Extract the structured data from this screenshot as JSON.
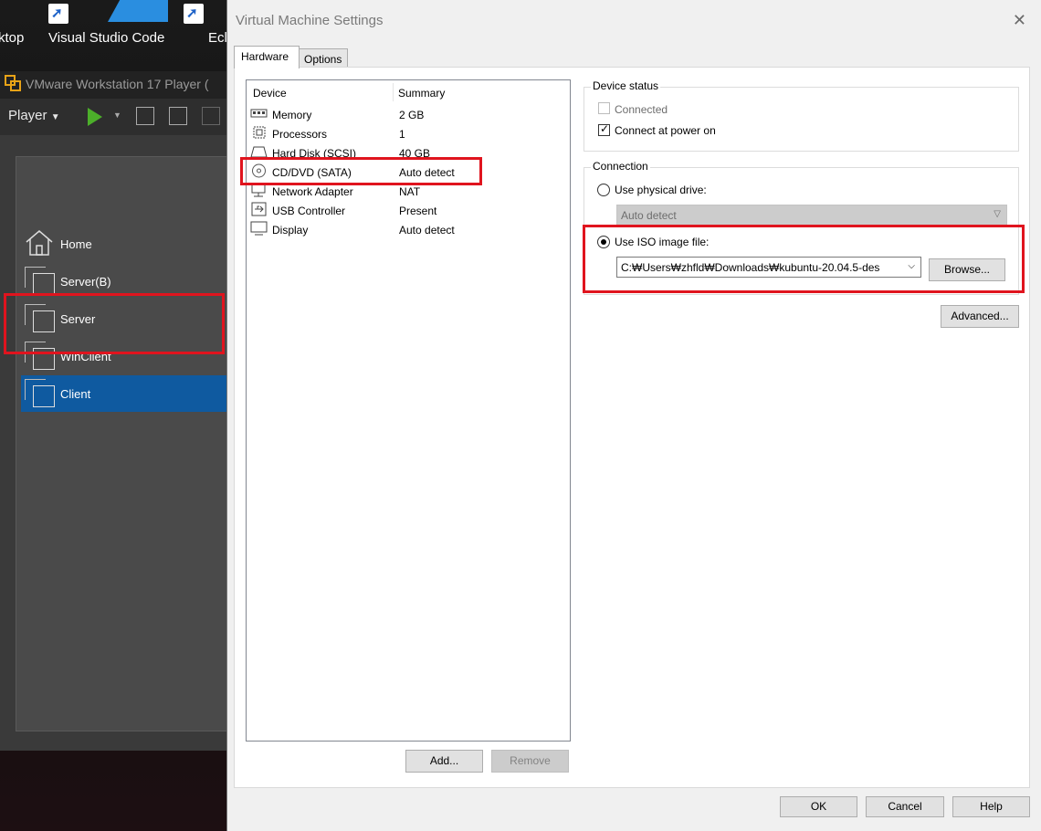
{
  "desktop": {
    "icons": [
      {
        "label": "ktop"
      },
      {
        "label": "Visual Studio Code"
      },
      {
        "label": "Ecl"
      }
    ]
  },
  "vmware": {
    "title": "VMware Workstation 17 Player (",
    "player_menu": "Player",
    "library": [
      {
        "label": "Home",
        "icon": "home-icon"
      },
      {
        "label": "Server(B)",
        "icon": "vm-icon"
      },
      {
        "label": "Server",
        "icon": "vm-icon"
      },
      {
        "label": "WinClient",
        "icon": "vm-icon"
      },
      {
        "label": "Client",
        "icon": "vm-icon",
        "selected": true
      }
    ]
  },
  "dialog": {
    "title": "Virtual Machine Settings",
    "tabs": [
      {
        "label": "Hardware",
        "active": true
      },
      {
        "label": "Options",
        "active": false
      }
    ],
    "device_table": {
      "columns": [
        "Device",
        "Summary"
      ],
      "rows": [
        {
          "device": "Memory",
          "summary": "2 GB",
          "icon": "memory-icon"
        },
        {
          "device": "Processors",
          "summary": "1",
          "icon": "processor-icon"
        },
        {
          "device": "Hard Disk (SCSI)",
          "summary": "40 GB",
          "icon": "hard-disk-icon"
        },
        {
          "device": "CD/DVD (SATA)",
          "summary": "Auto detect",
          "icon": "cd-dvd-icon",
          "selected": true
        },
        {
          "device": "Network Adapter",
          "summary": "NAT",
          "icon": "network-adapter-icon"
        },
        {
          "device": "USB Controller",
          "summary": "Present",
          "icon": "usb-icon"
        },
        {
          "device": "Display",
          "summary": "Auto detect",
          "icon": "display-icon"
        }
      ]
    },
    "add_button": "Add...",
    "remove_button": "Remove",
    "device_status": {
      "title": "Device status",
      "connected": {
        "label": "Connected",
        "checked": false,
        "enabled": false
      },
      "connect_at_power_on": {
        "label": "Connect at power on",
        "checked": true,
        "enabled": true
      }
    },
    "connection": {
      "title": "Connection",
      "physical_drive": {
        "label": "Use physical drive:",
        "selected": false,
        "value": "Auto detect"
      },
      "iso_image": {
        "label": "Use ISO image file:",
        "selected": true,
        "value": "C:₩Users₩zhfld₩Downloads₩kubuntu-20.04.5-des"
      },
      "browse_button": "Browse..."
    },
    "advanced_button": "Advanced...",
    "footer": {
      "ok": "OK",
      "cancel": "Cancel",
      "help": "Help"
    },
    "colors": {
      "highlight": "#e0141e",
      "selection": "#0f5aa0"
    }
  }
}
